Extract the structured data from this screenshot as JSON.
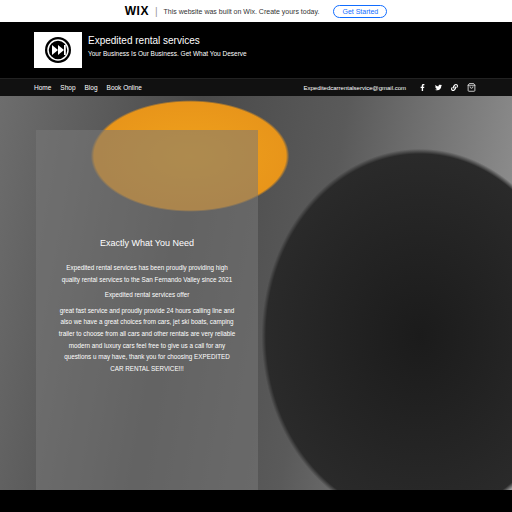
{
  "banner": {
    "logo": "WIX",
    "separator": "|",
    "message": "This website was built on Wix. Create yours today.",
    "button": "Get Started"
  },
  "header": {
    "title": "Expedited rental services",
    "subtitle": "Your Business Is Our Business. Get What You Deserve"
  },
  "nav": {
    "items": [
      {
        "label": "Home"
      },
      {
        "label": "Shop"
      },
      {
        "label": "Blog"
      },
      {
        "label": "Book Online"
      }
    ],
    "email": "Expeditedcarrentalservice@gmail.com"
  },
  "hero": {
    "heading": "Exactly What You Need",
    "paragraphs": [
      "Expedited rental services has been proudly providing high quality rental services to the San Fernando Valley since 2021",
      "Expedited rental services offer",
      "great fast service and proudly provide  24 hours calling line and also we have a great choices from cars, jet ski boats, camping trailer to choose from all cars and other rentals  are very reliable modern and luxury cars feel free to give us a call for any questions u may have, thank you for choosing EXPEDITED CAR RENTAL SERVICE!!!"
    ]
  }
}
